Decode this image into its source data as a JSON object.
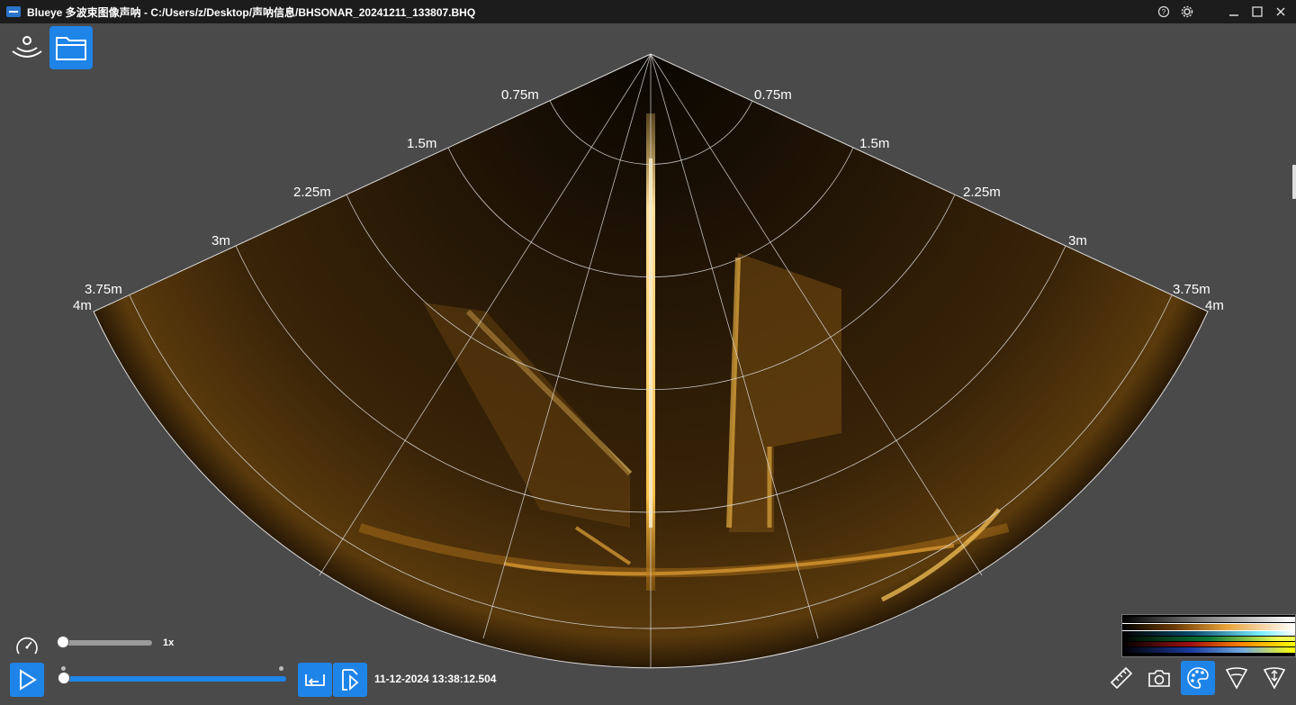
{
  "window": {
    "title": "Blueye 多波束图像声呐 - C:/Users/z/Desktop/声呐信息/BHSONAR_20241211_133807.BHQ",
    "help_icon": "help-circle-icon",
    "settings_icon": "gear-icon",
    "minimize_icon": "minimize-icon",
    "maximize_icon": "maximize-icon"
  },
  "toolbar": {
    "sonar_icon": "sonar-wave-icon",
    "folder_icon": "folder-icon"
  },
  "sonar_view": {
    "range_labels": [
      "0.75m",
      "1.5m",
      "2.25m",
      "3m",
      "3.75m"
    ],
    "max_range_label": "4m",
    "accent_color": "#e8a23a"
  },
  "playback": {
    "speed_icon": "speedometer-icon",
    "speed_value": "1x",
    "speed_fraction": 0.0,
    "progress_fraction": 0.0,
    "play_icon": "play-icon",
    "loop_icon": "loop-icon",
    "export_icon": "export-icon",
    "timestamp": "11-12-2024 13:38:12.504"
  },
  "bottom_tools": {
    "ruler_icon": "ruler-icon",
    "camera_icon": "camera-icon",
    "palette_icon": "palette-icon",
    "sector_icon": "sector-icon",
    "range_icon": "range-icon",
    "active_color": "#1f84e8"
  }
}
